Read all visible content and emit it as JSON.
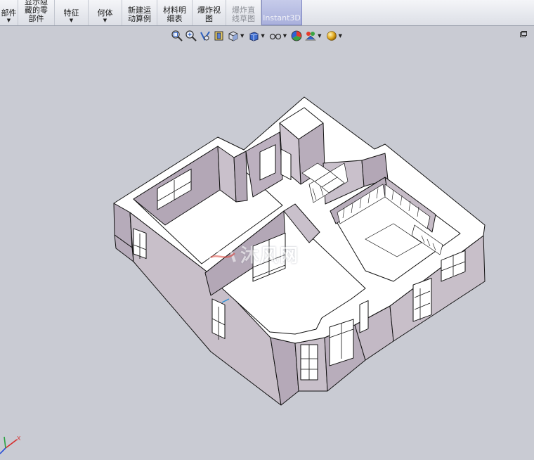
{
  "ribbon": {
    "buttons": [
      {
        "id": "parts",
        "label": "部件",
        "dropdown": true,
        "width": 26,
        "state": "normal"
      },
      {
        "id": "show-hidden",
        "label": "显示隐\n藏的零\n部件",
        "dropdown": false,
        "width": 52,
        "state": "normal"
      },
      {
        "id": "features",
        "label": "特征",
        "dropdown": true,
        "width": 48,
        "state": "normal"
      },
      {
        "id": "geometry",
        "label": "何体",
        "dropdown": true,
        "width": 48,
        "state": "normal"
      },
      {
        "id": "new-motion",
        "label": "新建运\n动算例",
        "dropdown": false,
        "width": 50,
        "state": "normal"
      },
      {
        "id": "bom",
        "label": "材料明\n细表",
        "dropdown": false,
        "width": 50,
        "state": "normal"
      },
      {
        "id": "exploded-view",
        "label": "爆炸视\n图",
        "dropdown": false,
        "width": 48,
        "state": "normal"
      },
      {
        "id": "explode-line",
        "label": "爆炸直\n线草图",
        "dropdown": false,
        "width": 50,
        "state": "disabled"
      },
      {
        "id": "instant3d",
        "label": "Instant3D",
        "dropdown": false,
        "width": 58,
        "state": "active"
      }
    ]
  },
  "hud": {
    "tools": [
      {
        "id": "zoom-to-fit",
        "icon": "zoom-fit-icon",
        "dropdown": false
      },
      {
        "id": "zoom-area",
        "icon": "zoom-area-icon",
        "dropdown": false
      },
      {
        "id": "previous-view",
        "icon": "previous-view-icon",
        "dropdown": false
      },
      {
        "id": "section-view",
        "icon": "section-view-icon",
        "dropdown": false
      },
      {
        "id": "view-orientation",
        "icon": "view-orientation-icon",
        "dropdown": true
      },
      {
        "id": "display-style",
        "icon": "display-style-icon",
        "dropdown": true
      },
      {
        "id": "hide-show",
        "icon": "hide-show-icon",
        "dropdown": true
      },
      {
        "id": "edit-appearance",
        "icon": "appearance-icon",
        "dropdown": false
      },
      {
        "id": "apply-scene",
        "icon": "scene-icon",
        "dropdown": true
      },
      {
        "id": "view-settings",
        "icon": "view-settings-icon",
        "dropdown": true
      }
    ]
  },
  "colors": {
    "viewport_bg": "#c9cbd3",
    "wall_top": "#ffffff",
    "wall_face": "#c8bfc9",
    "wall_face_dark": "#a99eae",
    "floor": "#ffffff",
    "outline": "#111111"
  },
  "watermark": {
    "text": "沐风网"
  },
  "triad": {
    "x_label": "X",
    "y_label": "Y"
  }
}
